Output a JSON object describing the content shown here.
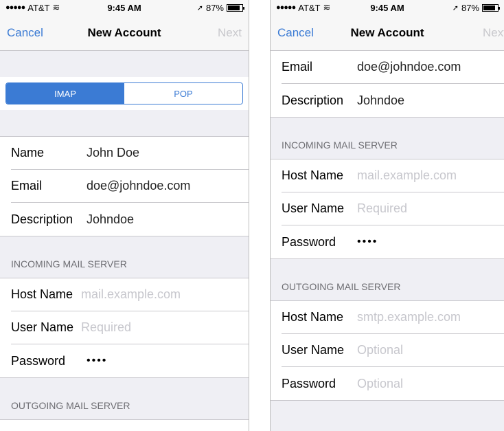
{
  "status": {
    "carrier": "AT&T",
    "time": "9:45 AM",
    "battery": "87%",
    "battery_level": 0.87
  },
  "nav": {
    "cancel": "Cancel",
    "title": "New Account",
    "next": "Next"
  },
  "account_type": {
    "options": [
      "IMAP",
      "POP"
    ],
    "selected": "IMAP"
  },
  "account": {
    "name_label": "Name",
    "name_value": "John Doe",
    "email_label": "Email",
    "email_value": "doe@johndoe.com",
    "description_label": "Description",
    "description_value": "Johndoe"
  },
  "incoming": {
    "header": "INCOMING MAIL SERVER",
    "host_label": "Host Name",
    "host_placeholder": "mail.example.com",
    "user_label": "User Name",
    "user_placeholder": "Required",
    "password_label": "Password",
    "password_value": "••••"
  },
  "outgoing": {
    "header": "OUTGOING MAIL SERVER",
    "host_label": "Host Name",
    "host_placeholder": "smtp.example.com",
    "user_label": "User Name",
    "user_placeholder": "Optional",
    "password_label": "Password",
    "password_placeholder": "Optional"
  },
  "colors": {
    "accent": "#3b7bd4",
    "background": "#efeff4",
    "placeholder": "#c7c7cd",
    "separator": "#c8c7cc"
  }
}
